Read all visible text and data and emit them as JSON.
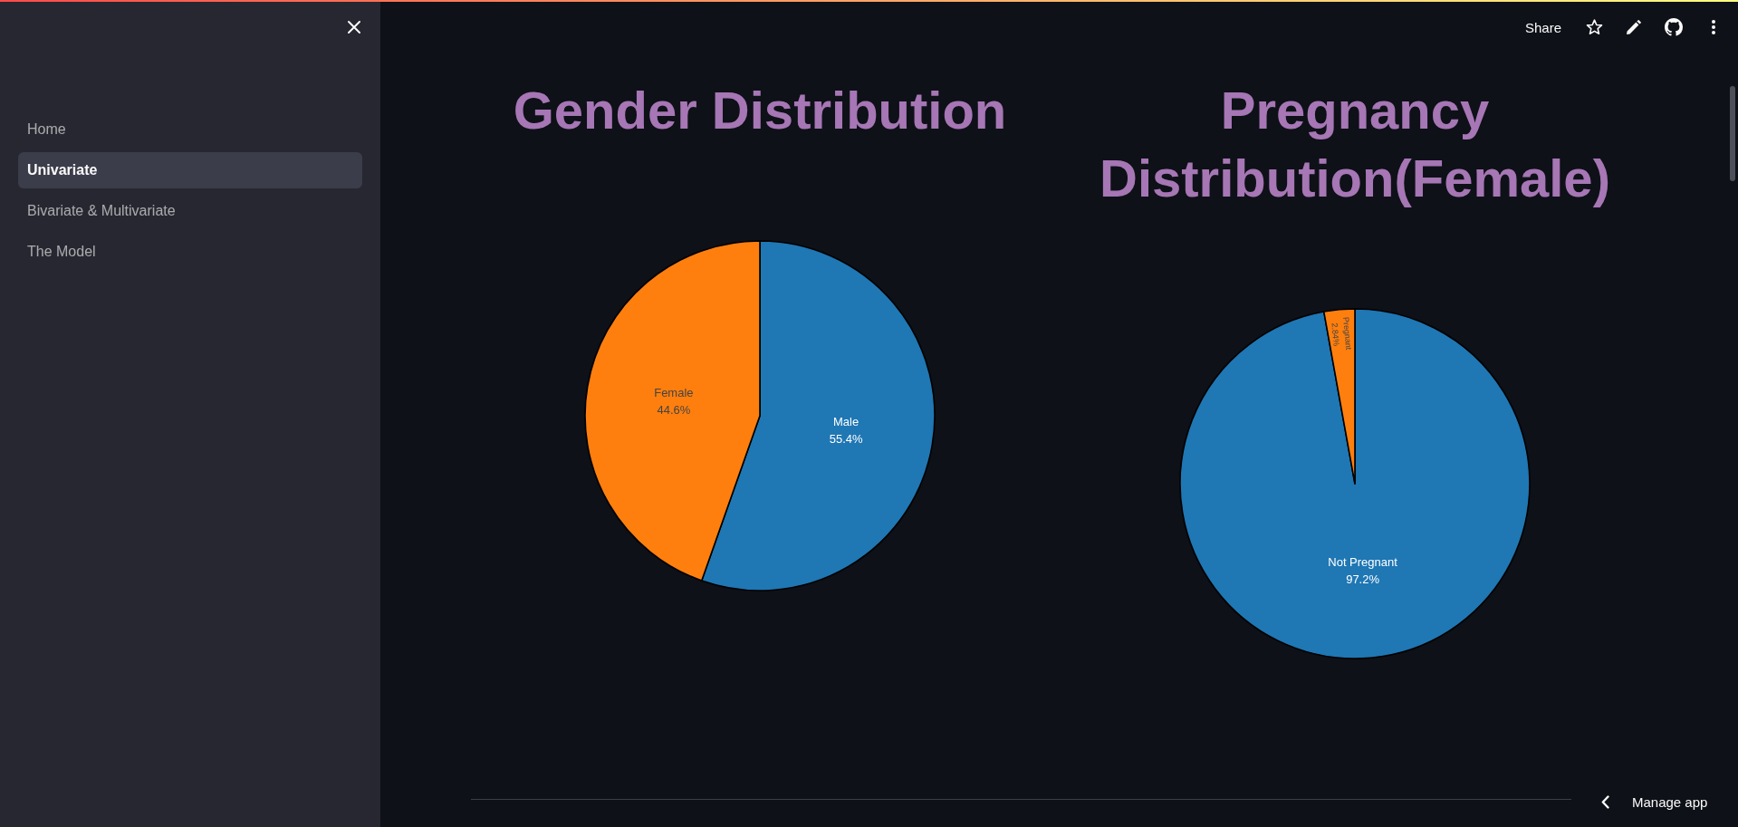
{
  "sidebar": {
    "items": [
      {
        "label": "Home",
        "selected": false
      },
      {
        "label": "Univariate",
        "selected": true
      },
      {
        "label": "Bivariate & Multivariate",
        "selected": false
      },
      {
        "label": "The Model",
        "selected": false
      }
    ]
  },
  "toolbar": {
    "share": "Share"
  },
  "charts": [
    {
      "chart_data": {
        "type": "pie",
        "title": "Gender Distribution",
        "categories": [
          "Male",
          "Female"
        ],
        "values": [
          55.4,
          44.6
        ],
        "value_labels": [
          "55.4%",
          "44.6%"
        ],
        "colors": [
          "#1f77b4",
          "#ff7f0e"
        ]
      }
    },
    {
      "chart_data": {
        "type": "pie",
        "title": "Pregnancy Distribution(Female)",
        "categories": [
          "Not Pregnant",
          "Pregnant"
        ],
        "values": [
          97.2,
          2.84
        ],
        "value_labels": [
          "97.2%",
          "2.84%"
        ],
        "colors": [
          "#1f77b4",
          "#ff7f0e"
        ]
      }
    }
  ],
  "manage_app": {
    "label": "Manage app"
  }
}
